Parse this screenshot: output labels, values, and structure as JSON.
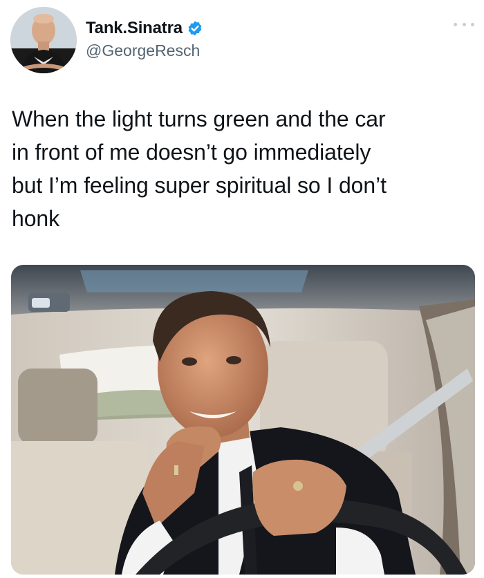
{
  "author": {
    "display_name": "Tank.Sinatra",
    "handle": "@GeorgeResch",
    "verified": true,
    "verified_color": "#1d9bf0"
  },
  "tweet": {
    "text": "When the light turns green and the car\nin front of me doesn’t go immediately\nbut I’m feeling super spiritual so I don’t\nhonk"
  },
  "media": {
    "type": "photo"
  },
  "icons": {
    "more": "more-options-icon",
    "verified": "verified-badge-icon"
  }
}
